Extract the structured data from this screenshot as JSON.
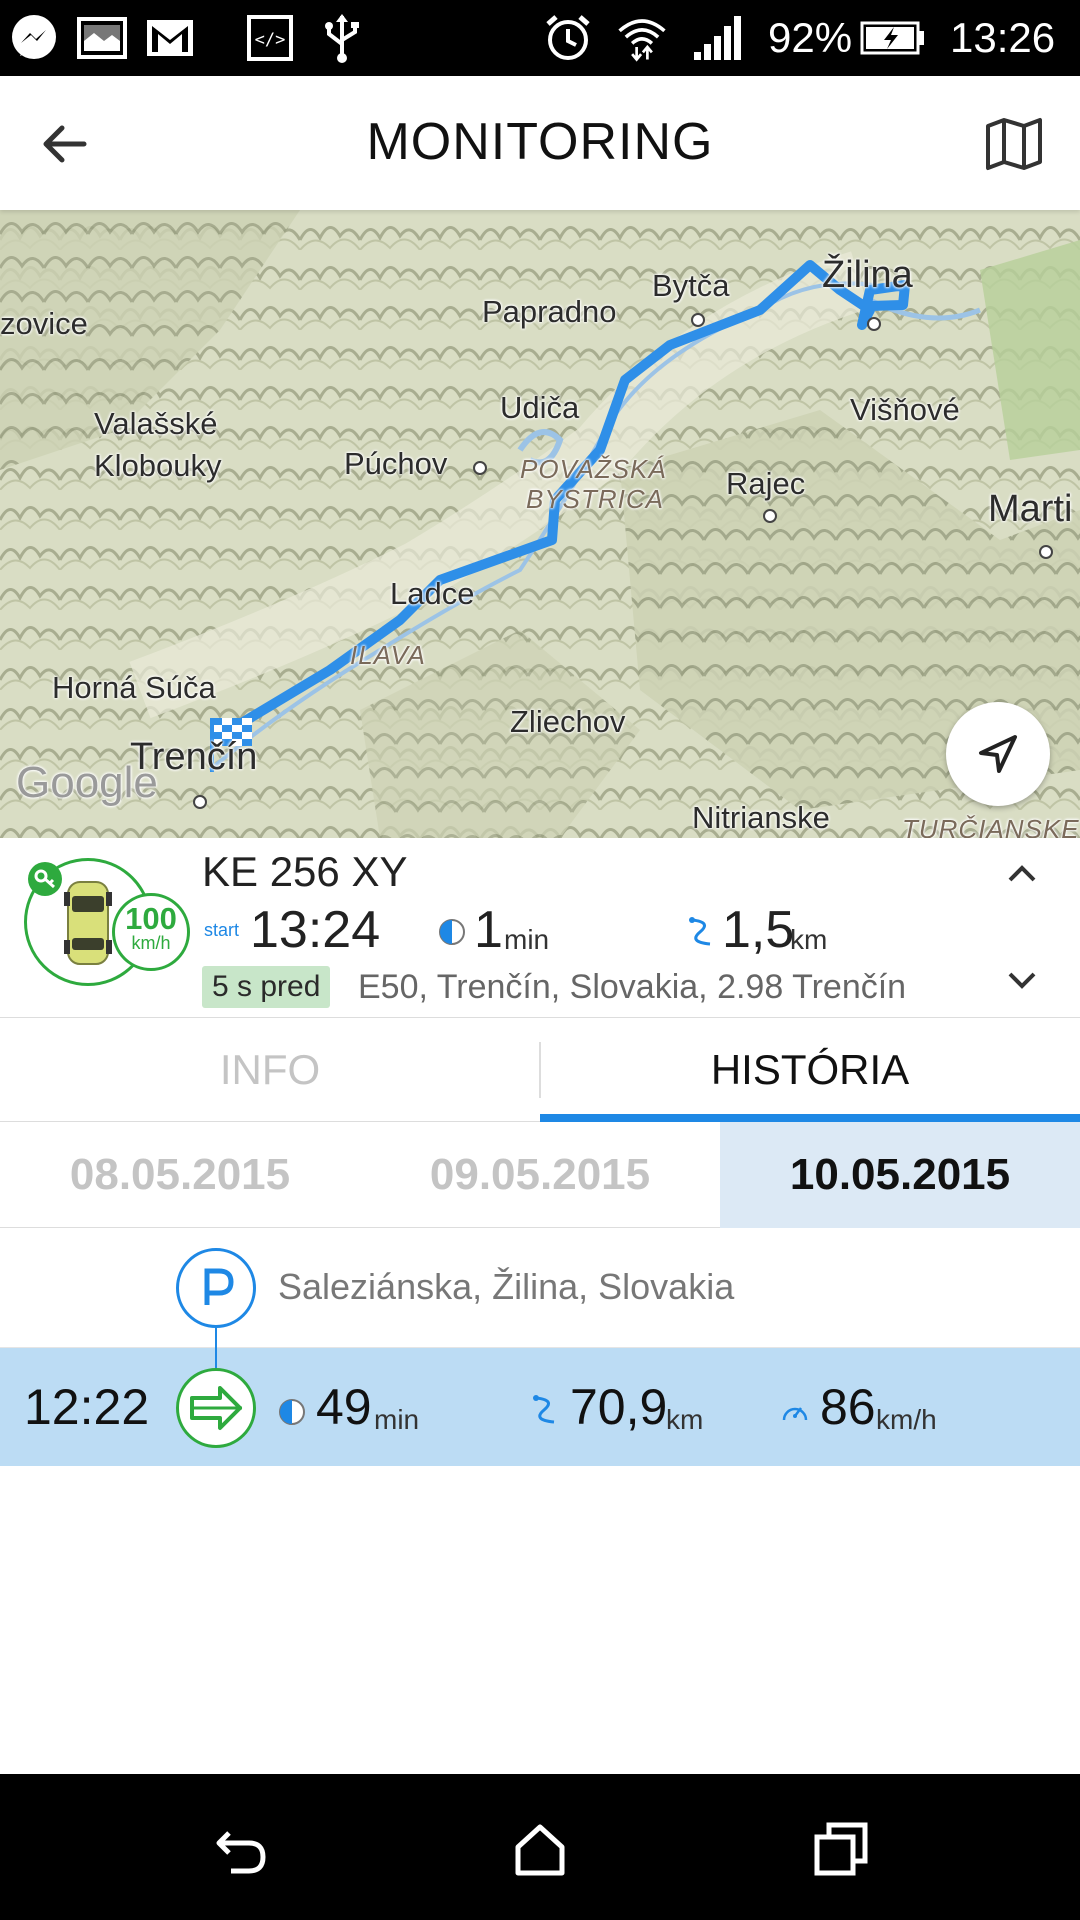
{
  "status_bar": {
    "battery": "92%",
    "time": "13:26",
    "icons": [
      "messenger-icon",
      "gallery-icon",
      "gmail-icon",
      "code-icon",
      "usb-icon",
      "alarm-icon",
      "wifi-icon",
      "signal-icon",
      "battery-charging-icon"
    ]
  },
  "app_bar": {
    "title": "MONITORING",
    "back_icon": "arrow-left-icon",
    "map_icon": "map-icon"
  },
  "map": {
    "labels": [
      "zovice",
      "Bytča",
      "Žilina",
      "Papradno",
      "Valašské",
      "Klobouky",
      "Udiča",
      "Púchov",
      "POVAŽSKÁ",
      "BYSTRICA",
      "Višňové",
      "Rajec",
      "Marti",
      "Ladce",
      "ILAVA",
      "Horná Súča",
      "Trenčín",
      "Zliechov",
      "Nitrianske",
      "TURČIANSKE",
      "Google"
    ],
    "route_color": "#2f8fe8",
    "locate_icon": "navigation-arrow-icon"
  },
  "vehicle": {
    "plate": "KE 256 XY",
    "speed": "100",
    "speed_unit": "km/h",
    "start_label": "start",
    "start_time": "13:24",
    "duration": "1",
    "duration_unit": "min",
    "distance": "1,5",
    "distance_unit": "km",
    "ago": "5 s pred",
    "address": "E50, Trenčín, Slovakia, 2.98  Trenčín",
    "status_color": "#2eaa3e"
  },
  "tabs": [
    {
      "label": "INFO",
      "active": false
    },
    {
      "label": "HISTÓRIA",
      "active": true
    }
  ],
  "dates": [
    {
      "label": "08.05.2015",
      "selected": false
    },
    {
      "label": "09.05.2015",
      "selected": false
    },
    {
      "label": "10.05.2015",
      "selected": true
    }
  ],
  "history": {
    "parking": {
      "address": "Saleziánska, Žilina, Slovakia"
    },
    "trip": {
      "time": "12:22",
      "duration": "49",
      "duration_unit": "min",
      "distance": "70,9",
      "distance_unit": "km",
      "speed": "86",
      "speed_unit": "km/h"
    }
  },
  "nav_bar": {
    "icons": [
      "back-icon",
      "home-icon",
      "recents-icon"
    ]
  },
  "colors": {
    "accent": "#1e88e5",
    "green": "#2eaa3e",
    "selected_bg": "#dce9f5",
    "trip_bg": "#bcdcf4"
  }
}
